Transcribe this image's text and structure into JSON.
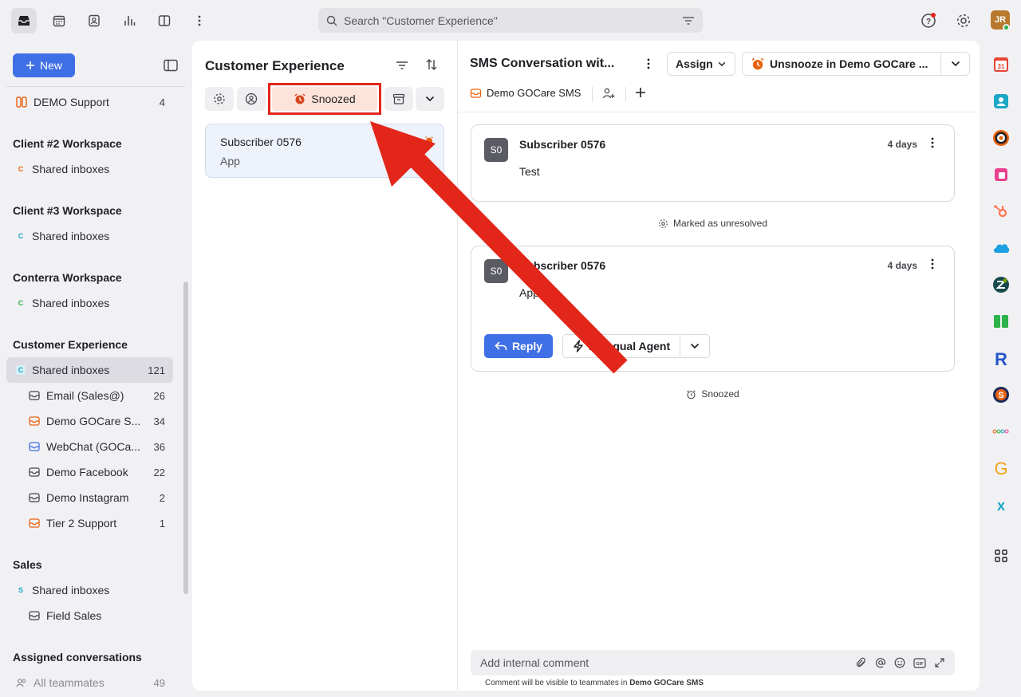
{
  "top": {
    "search_placeholder": "Search \"Customer Experience\"",
    "user_initials": "JR"
  },
  "sidebar": {
    "new_label": "New",
    "demo_support": {
      "label": "DEMO Support",
      "count": "4"
    },
    "sections": [
      {
        "title": "Client #2 Workspace",
        "badge": "C",
        "badge_color": "#e8620f",
        "item": "Shared inboxes"
      },
      {
        "title": "Client #3 Workspace",
        "badge": "C",
        "badge_color": "#1aa6c6",
        "item": "Shared inboxes"
      },
      {
        "title": "Conterra Workspace",
        "badge": "C",
        "badge_color": "#2db34a",
        "item": "Shared inboxes"
      }
    ],
    "cx": {
      "title": "Customer Experience",
      "shared": {
        "badge": "C",
        "label": "Shared inboxes",
        "count": "121"
      },
      "inboxes": [
        {
          "label": "Email (Sales@)",
          "count": "26"
        },
        {
          "label": "Demo GOCare S...",
          "count": "34"
        },
        {
          "label": "WebChat (GOCa...",
          "count": "36"
        },
        {
          "label": "Demo Facebook",
          "count": "22"
        },
        {
          "label": "Demo Instagram",
          "count": "2"
        },
        {
          "label": "Tier 2 Support",
          "count": "1"
        }
      ]
    },
    "sales": {
      "title": "Sales",
      "badge": "S",
      "shared": "Shared inboxes",
      "field": "Field Sales"
    },
    "assigned": {
      "title": "Assigned conversations",
      "all": "All teammates",
      "count": "49"
    }
  },
  "list": {
    "title": "Customer Experience",
    "snoozed_label": "Snoozed",
    "card": {
      "name": "Subscriber 0576",
      "snippet": "App"
    }
  },
  "conversation": {
    "title": "SMS Conversation wit...",
    "assign_label": "Assign",
    "unsnooze_label": "Unsnooze in Demo GOCare ...",
    "inbox_tag": "Demo GOCare SMS",
    "messages": [
      {
        "initials": "S0",
        "sender": "Subscriber 0576",
        "time": "4 days",
        "body": "Test"
      },
      {
        "initials": "S0",
        "sender": "Subscriber 0576",
        "time": "4 days",
        "body": "App"
      }
    ],
    "event_unresolved": "Marked as unresolved",
    "event_snoozed": "Snoozed",
    "reply_label": "Reply",
    "agent_label": "Bilingual Agent",
    "comment_placeholder": "Add internal comment",
    "comment_hint_prefix": "Comment will be visible to teammates in ",
    "comment_hint_inbox": "Demo GOCare SMS"
  },
  "colors": {
    "accent": "#3f6fe4",
    "snoozed_bg": "#fde3da",
    "annotation": "#e3261a"
  }
}
